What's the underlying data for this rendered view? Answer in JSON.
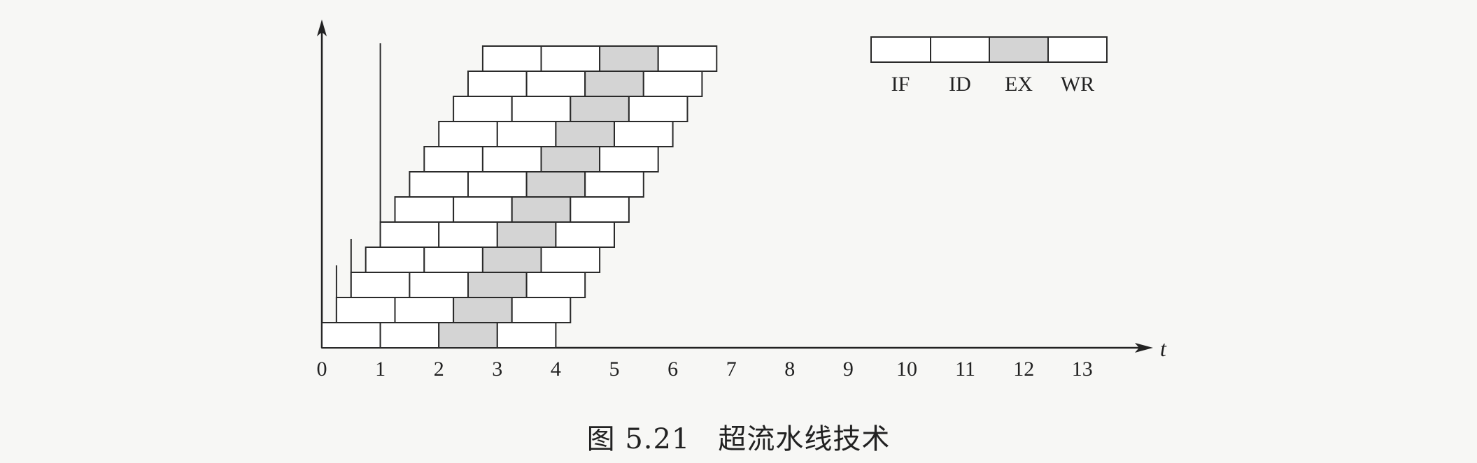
{
  "axis": {
    "x_label": "t",
    "ticks": [
      "0",
      "1",
      "2",
      "3",
      "4",
      "5",
      "6",
      "7",
      "8",
      "9",
      "10",
      "11",
      "12",
      "13"
    ]
  },
  "legend": {
    "stages": [
      "IF",
      "ID",
      "EX",
      "WR"
    ],
    "highlight_stage": "EX"
  },
  "pipeline": {
    "instruction_count": 12,
    "issue_interval": 0.25,
    "stage_duration": 1,
    "first_issue": 0,
    "shaded_stage_index": 2
  },
  "colors": {
    "stage_fill": "#ffffff",
    "shaded_fill": "#d4d4d4",
    "stroke": "#2a2a2a"
  },
  "caption": {
    "number": "图 5.21",
    "text": "超流水线技术"
  }
}
